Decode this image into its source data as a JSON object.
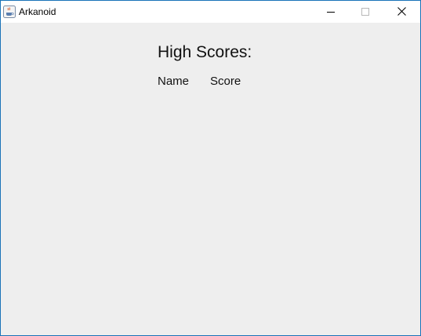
{
  "window": {
    "title": "Arkanoid",
    "app_icon": "java-cup-icon",
    "controls": {
      "minimize_icon": "minimize-icon",
      "maximize_icon": "maximize-icon",
      "close_icon": "close-icon"
    }
  },
  "high_scores": {
    "heading": "High Scores:",
    "columns": {
      "name": "Name",
      "score": "Score"
    }
  },
  "colors": {
    "window_border": "#1a73b8",
    "titlebar_bg": "#ffffff",
    "content_bg": "#eeeeee",
    "text": "#111111"
  }
}
